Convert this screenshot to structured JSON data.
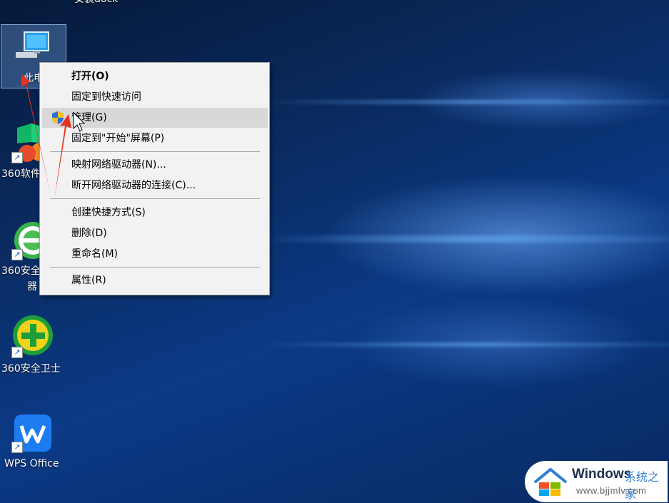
{
  "desktop": {
    "top_partial_label": "安装dock",
    "icons": [
      {
        "label": "此电",
        "icon": "this-pc-icon"
      },
      {
        "label": "360软件",
        "icon": "360-software-icon"
      },
      {
        "label_line1": "360安全",
        "label_line2": "器",
        "icon": "360-browser-icon"
      },
      {
        "label": "360安全卫士",
        "icon": "360-security-icon"
      },
      {
        "label": "WPS Office",
        "icon": "wps-office-icon"
      }
    ]
  },
  "context_menu": {
    "items": [
      {
        "label": "打开(O)",
        "bold": true
      },
      {
        "label": "固定到快速访问"
      },
      {
        "label": "管理(G)",
        "icon": "uac-shield-icon",
        "highlighted": true
      },
      {
        "label": "固定到\"开始\"屏幕(P)"
      },
      {
        "label": "映射网络驱动器(N)..."
      },
      {
        "label": "断开网络驱动器的连接(C)..."
      },
      {
        "label": "创建快捷方式(S)"
      },
      {
        "label": "删除(D)"
      },
      {
        "label": "重命名(M)"
      },
      {
        "label": "属性(R)"
      }
    ]
  },
  "watermark": {
    "brand": "Windows",
    "cn": "系统之家",
    "url": "www.bjjmlv.com"
  },
  "colors": {
    "annotation_arrow": "#e8321e",
    "menu_bg": "#f2f2f2",
    "menu_highlight": "#d8d8d8"
  }
}
